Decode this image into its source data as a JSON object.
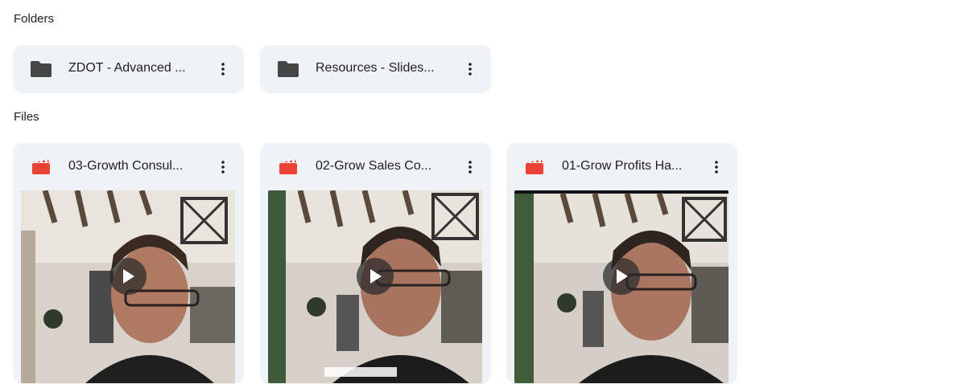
{
  "sections": {
    "folders_title": "Folders",
    "files_title": "Files"
  },
  "folders": [
    {
      "name": "ZDOT - Advanced ...",
      "icon": "folder-icon"
    },
    {
      "name": "Resources - Slides...",
      "icon": "folder-icon"
    }
  ],
  "files": [
    {
      "name": "03-Growth Consul...",
      "icon": "video-file-icon"
    },
    {
      "name": "02-Grow Sales Co...",
      "icon": "video-file-icon"
    },
    {
      "name": "01-Grow Profits Ha...",
      "icon": "video-file-icon"
    }
  ],
  "colors": {
    "card_background": "#eff2f7",
    "folder_icon": "#444746",
    "video_icon": "#ea4335",
    "text": "#1f1f1f"
  }
}
